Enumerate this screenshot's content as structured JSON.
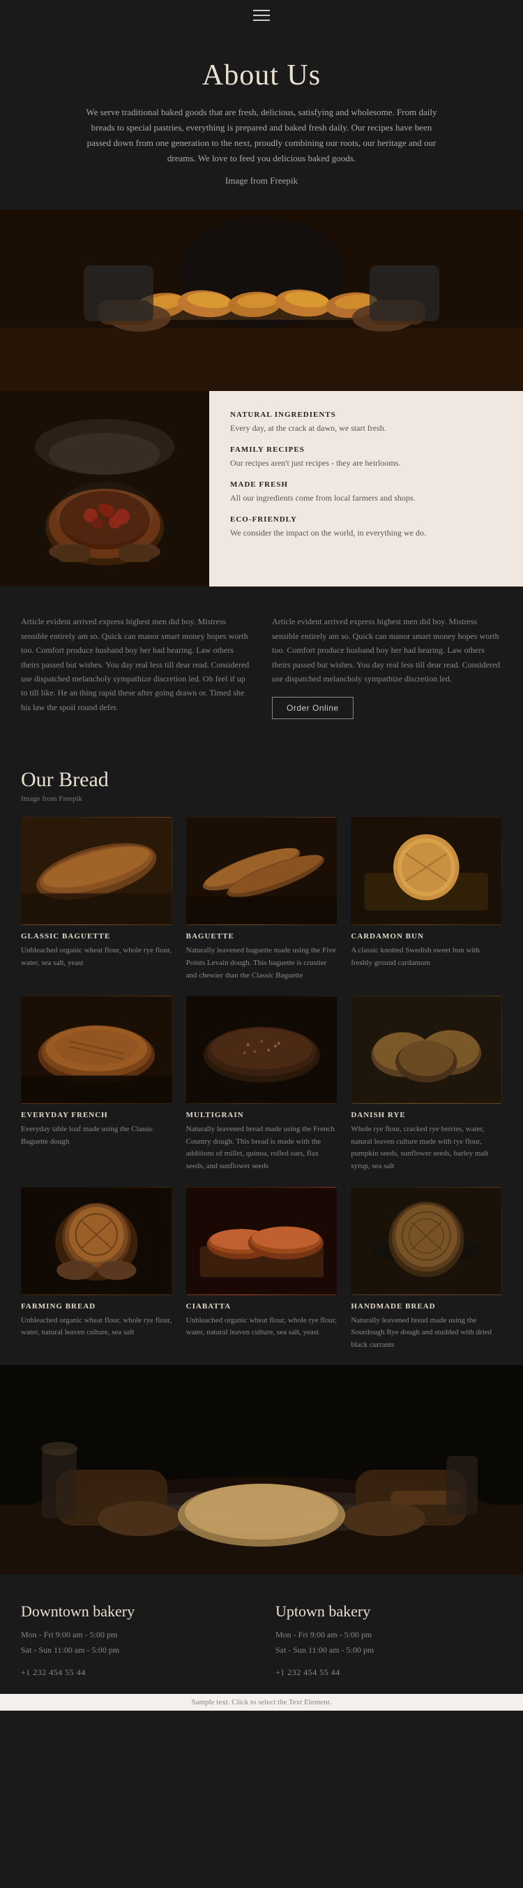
{
  "nav": {
    "menu_icon_label": "menu"
  },
  "about": {
    "title": "About Us",
    "description": "We serve traditional baked goods that are fresh, delicious, satisfying and wholesome. From daily breads to special pastries, everything is prepared and baked fresh daily. Our recipes have been passed down from one generation to the next, proudly combining our roots, our heritage and our dreams. We love to feed you delicious baked goods.",
    "image_credit": "Image from Freepik"
  },
  "features": {
    "items": [
      {
        "title": "NATURAL INGREDIENTS",
        "text": "Every day, at the crack at dawn, we start fresh."
      },
      {
        "title": "FAMILY RECIPES",
        "text": "Our recipes aren't just recipes - they are heirlooms."
      },
      {
        "title": "MADE FRESH",
        "text": "All our ingredients come from local farmers and shops."
      },
      {
        "title": "ECO-FRIENDLY",
        "text": "We consider the impact on the world, in everything we do."
      }
    ]
  },
  "article": {
    "left_text": "Article evident arrived express highest men did boy. Mistress sensible entirely am so. Quick can manor smart money hopes worth too. Comfort produce husband boy her had hearing. Law others theirs passed but wishes. You day real less till dear read. Considered use dispatched melancholy sympathize discretion led. Oh feel if up to till like. He an thing rapid these after going drawn or. Timed she his law the spoil round defer.",
    "right_text": "Article evident arrived express highest men did boy. Mistress sensible entirely am so. Quick can manor smart money hopes worth too. Comfort produce husband boy her had hearing. Law others theirs passed but wishes. You day real less till dear read. Considered use dispatched melancholy sympathize discretion led.",
    "order_btn_label": "Order Online"
  },
  "bread_section": {
    "title": "Our Bread",
    "image_credit": "Image from Freepik",
    "items": [
      {
        "id": "glassic-baguette",
        "name": "GLASSIC BAGUETTE",
        "description": "Unbleached organic wheat flour, whole rye flour, water, sea salt, yeast",
        "img_class": "img-glassic-baguette"
      },
      {
        "id": "baguette",
        "name": "BAGUETTE",
        "description": "Naturally leavened baguette made using the Five Points Levain dough. This baguette is crustier and chewier than the Classic Baguette",
        "img_class": "img-baguette"
      },
      {
        "id": "cardamon-bun",
        "name": "CARDAMON BUN",
        "description": "A classic knotted Swedish sweet bun with freshly ground cardamom",
        "img_class": "img-cardamon-bun"
      },
      {
        "id": "everyday-french",
        "name": "EVERYDAY FRENCH",
        "description": "Everyday table loaf made using the Classic Baguette dough",
        "img_class": "img-everyday-french"
      },
      {
        "id": "multigrain",
        "name": "MULTIGRAIN",
        "description": "Naturally leavened bread made using the French Country dough. This bread is made with the additions of millet, quinoa, rolled oats, flax seeds, and sunflower seeds",
        "img_class": "img-multigrain"
      },
      {
        "id": "danish-rye",
        "name": "DANISH RYE",
        "description": "Whole rye flour, cracked rye berries, water, natural leaven culture made with rye flour, pumpkin seeds, sunflower seeds, barley malt syrup, sea salt",
        "img_class": "img-danish-rye"
      },
      {
        "id": "farming-bread",
        "name": "FARMING BREAD",
        "description": "Unbleached organic wheat flour, whole rye flour, water, natural leaven culture, sea salt",
        "img_class": "img-farming-bread"
      },
      {
        "id": "ciabatta",
        "name": "CIABATTA",
        "description": "Unbleached organic wheat flour, whole rye flour, water, natural leaven culture, sea salt, yeast",
        "img_class": "img-ciabatta"
      },
      {
        "id": "handmade-bread",
        "name": "HANDMADE BREAD",
        "description": "Naturally leavened bread made using the Sourdough Rye dough and studded with dried black currants",
        "img_class": "img-handmade"
      }
    ]
  },
  "locations": {
    "downtown": {
      "title": "Downtown bakery",
      "hours1": "Mon - Fri  9:00 am - 5:00 pm",
      "hours2": "Sat - Sun  11:00 am - 5:00 pm",
      "phone": "+1 232 454 55 44"
    },
    "uptown": {
      "title": "Uptown bakery",
      "hours1": "Mon - Fri  9:00 am - 5:00 pm",
      "hours2": "Sat - Sun  11:00 am - 5:00 pm",
      "phone": "+1 232 454 55 44"
    }
  },
  "footer": {
    "sample_text": "Sample text. Click to select the Text Element."
  }
}
